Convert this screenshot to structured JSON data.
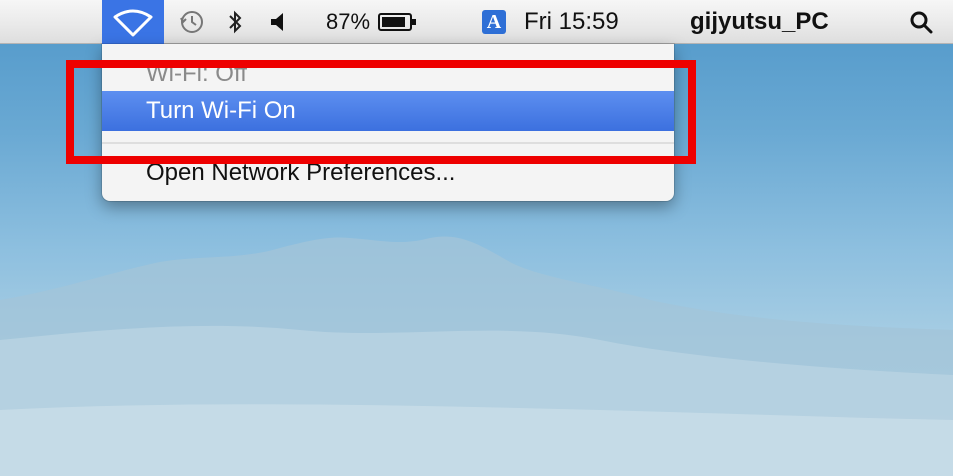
{
  "menubar": {
    "status_items": [
      {
        "name": "wifi",
        "icon": "wifi-icon",
        "active": true
      },
      {
        "name": "time-machine",
        "icon": "time-machine-icon"
      },
      {
        "name": "bluetooth",
        "icon": "bluetooth-icon"
      },
      {
        "name": "volume",
        "icon": "speaker-icon"
      }
    ],
    "battery": {
      "percent_label": "87%",
      "icon": "battery-icon"
    },
    "input_source": {
      "label": "A",
      "icon": "input-source-icon"
    },
    "clock": "Fri 15:59",
    "user": "gijyutsu_PC",
    "spotlight_icon": "search-icon"
  },
  "wifi_menu": {
    "status": "Wi-Fi: Off",
    "items": [
      {
        "label": "Turn Wi-Fi On",
        "highlighted": true
      },
      {
        "label": "Open Network Preferences..."
      }
    ]
  },
  "colors": {
    "menu_highlight": "#3c70df",
    "wifi_item_active": "#3a74e5",
    "annotation_box": "#ee0000"
  }
}
